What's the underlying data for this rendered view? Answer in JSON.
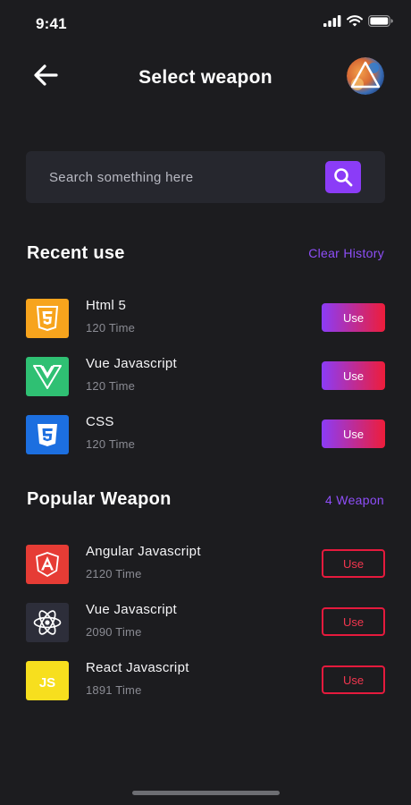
{
  "status_bar": {
    "time": "9:41"
  },
  "header": {
    "title": "Select weapon"
  },
  "search": {
    "placeholder": "Search something here"
  },
  "recent": {
    "title": "Recent use",
    "link": "Clear History",
    "items": [
      {
        "name": "Html 5",
        "meta": "120 Time",
        "button": "Use",
        "icon": "html5-icon",
        "color": "#f7a41d"
      },
      {
        "name": "Vue Javascript",
        "meta": "120 Time",
        "button": "Use",
        "icon": "vue-icon",
        "color": "#2fc073"
      },
      {
        "name": "CSS",
        "meta": "120 Time",
        "button": "Use",
        "icon": "css3-icon",
        "color": "#1c6fe0"
      }
    ]
  },
  "popular": {
    "title": "Popular Weapon",
    "link": "4 Weapon",
    "items": [
      {
        "name": "Angular Javascript",
        "meta": "2120 Time",
        "button": "Use",
        "icon": "angular-icon",
        "color": "#e63c35"
      },
      {
        "name": "Vue Javascript",
        "meta": "2090 Time",
        "button": "Use",
        "icon": "react-atom-icon",
        "color": "#2d2e3a"
      },
      {
        "name": "React Javascript",
        "meta": "1891 Time",
        "button": "Use",
        "icon": "javascript-icon",
        "color": "#f7df1e"
      }
    ]
  },
  "colors": {
    "accent": "#8b3cf7",
    "danger": "#ee1d3a",
    "background": "#1c1c1f"
  }
}
